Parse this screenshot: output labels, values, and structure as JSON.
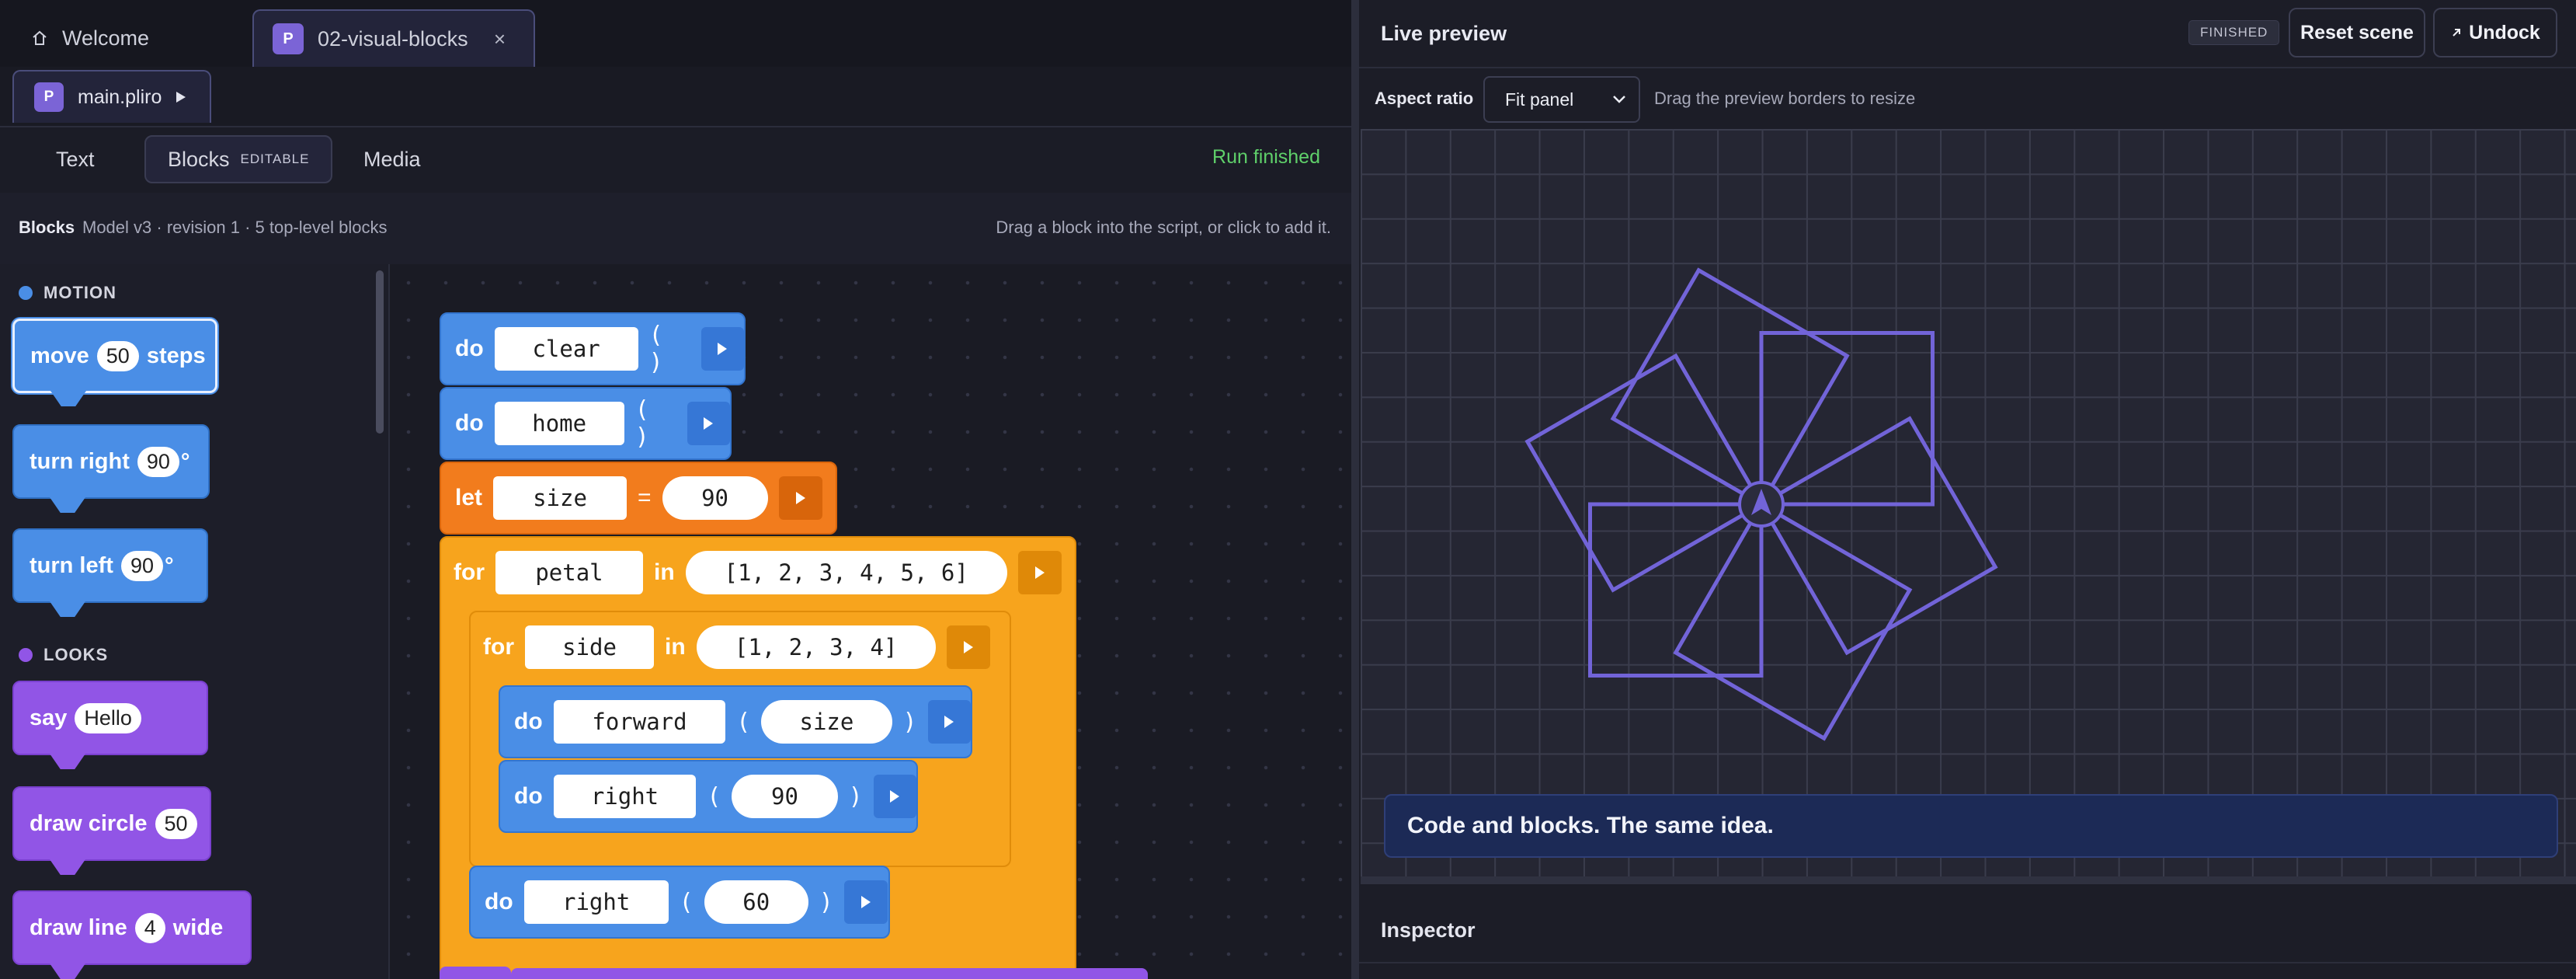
{
  "tabs": {
    "welcome": "Welcome",
    "file": "02-visual-blocks",
    "close": "×"
  },
  "file": {
    "logo": "P",
    "name": "main.pliro"
  },
  "modes": {
    "text": "Text",
    "blocks": "Blocks",
    "blocks_badge": "EDITABLE",
    "media": "Media",
    "status": "Run finished"
  },
  "blocks_info": {
    "title": "Blocks",
    "meta": "Model v3 · revision 1 · 5 top-level blocks",
    "hint": "Drag a block into the script, or click to add it."
  },
  "palette": {
    "motion_label": "MOTION",
    "looks_label": "LOOKS",
    "move": {
      "label": "move",
      "value": "50",
      "unit": "steps"
    },
    "turn_right": {
      "label": "turn right",
      "value": "90",
      "unit": "°"
    },
    "turn_left": {
      "label": "turn left",
      "value": "90",
      "unit": "°"
    },
    "say": {
      "label": "say",
      "value": "Hello"
    },
    "draw_circle": {
      "label": "draw circle",
      "value": "50"
    },
    "draw_line": {
      "label": "draw line",
      "value": "4",
      "unit": "wide"
    }
  },
  "script": {
    "do": "do",
    "let": "let",
    "for": "for",
    "in": "in",
    "eq": "=",
    "lparen": "(",
    "rparen": ")",
    "empty_parens": "( )",
    "b1_fn": "clear",
    "b2_fn": "home",
    "b3_var": "size",
    "b3_val": "90",
    "b4_var": "petal",
    "b4_list": "[1, 2, 3, 4, 5, 6]",
    "b5_var": "side",
    "b5_list": "[1, 2, 3, 4]",
    "b6_fn": "forward",
    "b6_arg": "size",
    "b7_fn": "right",
    "b7_arg": "90",
    "b8_fn": "right",
    "b8_arg": "60"
  },
  "preview": {
    "title": "Live preview",
    "status": "FINISHED",
    "reset": "Reset scene",
    "undock": "Undock",
    "aspect_label": "Aspect ratio",
    "aspect_value": "Fit panel",
    "aspect_hint": "Drag the preview borders to resize",
    "caption": "Code and blocks. The same idea.",
    "stroke_color": "#7264d8",
    "squares": 6,
    "square_side": 90,
    "turn_per_petal": 60
  },
  "inspector": {
    "title": "Inspector"
  },
  "colors": {
    "motion": "#4a8ee6",
    "looks": "#9155e6",
    "let": "#f27c1d",
    "control": "#f7a41d",
    "success": "#5fd06a"
  }
}
